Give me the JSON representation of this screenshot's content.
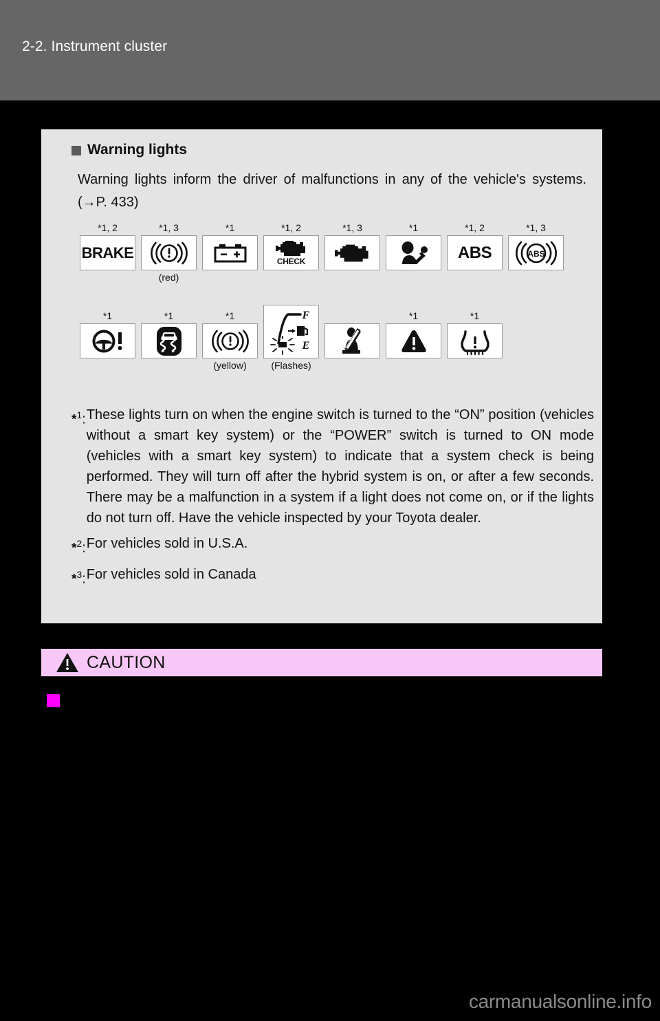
{
  "page": {
    "header_title": "2-2. Instrument cluster",
    "watermark": "carmanualsonline.info"
  },
  "section": {
    "heading": "Warning lights",
    "intro": "Warning lights inform the driver of malfunctions in any of the vehicle's systems. (→P. 433)"
  },
  "warning_lights": {
    "row1": [
      {
        "icon": "brake-warning-light-icon",
        "label": "BRAKE",
        "star": "*1, 2",
        "sub": ""
      },
      {
        "icon": "brake-system-red-warning-light-icon",
        "label": "",
        "star": "*1, 3",
        "sub": "(red)"
      },
      {
        "icon": "charging-system-battery-warning-light-icon",
        "label": "",
        "star": "*1",
        "sub": ""
      },
      {
        "icon": "malfunction-indicator-check-engine-icon",
        "label": "CHECK",
        "star": "*1, 2",
        "sub": ""
      },
      {
        "icon": "malfunction-indicator-engine-icon",
        "label": "",
        "star": "*1, 3",
        "sub": ""
      },
      {
        "icon": "srs-airbag-warning-light-icon",
        "label": "",
        "star": "*1",
        "sub": ""
      },
      {
        "icon": "abs-warning-light-icon",
        "label": "ABS",
        "star": "*1, 2",
        "sub": ""
      },
      {
        "icon": "abs-circle-warning-light-icon",
        "label": "ABS",
        "star": "*1, 3",
        "sub": ""
      }
    ],
    "row2": [
      {
        "icon": "electric-power-steering-warning-light-icon",
        "label": "",
        "star": "*1",
        "sub": ""
      },
      {
        "icon": "slip-indicator-vsc-warning-light-icon",
        "label": "",
        "star": "*1",
        "sub": ""
      },
      {
        "icon": "brake-system-yellow-warning-light-icon",
        "label": "",
        "star": "*1",
        "sub": "(yellow)"
      },
      {
        "icon": "low-fuel-level-gauge-warning-icon",
        "label": "",
        "star": "",
        "sub": "(Flashes)",
        "gauge_full": "F",
        "gauge_empty": "E"
      },
      {
        "icon": "driver-seat-belt-reminder-light-icon",
        "label": "",
        "star": "",
        "sub": ""
      },
      {
        "icon": "master-warning-light-icon",
        "label": "",
        "star": "*1",
        "sub": ""
      },
      {
        "icon": "tire-pressure-warning-light-icon",
        "label": "",
        "star": "*1",
        "sub": ""
      }
    ]
  },
  "footnotes": [
    {
      "marker_star": "*",
      "marker_num": "1",
      "marker_colon": ":",
      "text": "These lights turn on when the engine switch is turned to the “ON” position (vehicles without a smart key system) or the “POWER” switch is turned to ON mode (vehicles with a smart key system) to indicate that a system check is being performed. They will turn off after the hybrid system is on, or after a few seconds. There may be a malfunction in a system if a light does not come on, or if the lights do not turn off. Have the vehicle inspected by your Toyota dealer."
    },
    {
      "marker_star": "*",
      "marker_num": "2",
      "marker_colon": ":",
      "text": "For vehicles sold in U.S.A."
    },
    {
      "marker_star": "*",
      "marker_num": "3",
      "marker_colon": ":",
      "text": "For vehicles sold in Canada"
    }
  ],
  "caution": {
    "title": "CAUTION",
    "bar_color": "#f7c8f7",
    "bullet_color": "#ff00ff"
  },
  "colors": {
    "header_band": "#666666",
    "panel": "#e4e4e4",
    "page_background": "#000000"
  }
}
